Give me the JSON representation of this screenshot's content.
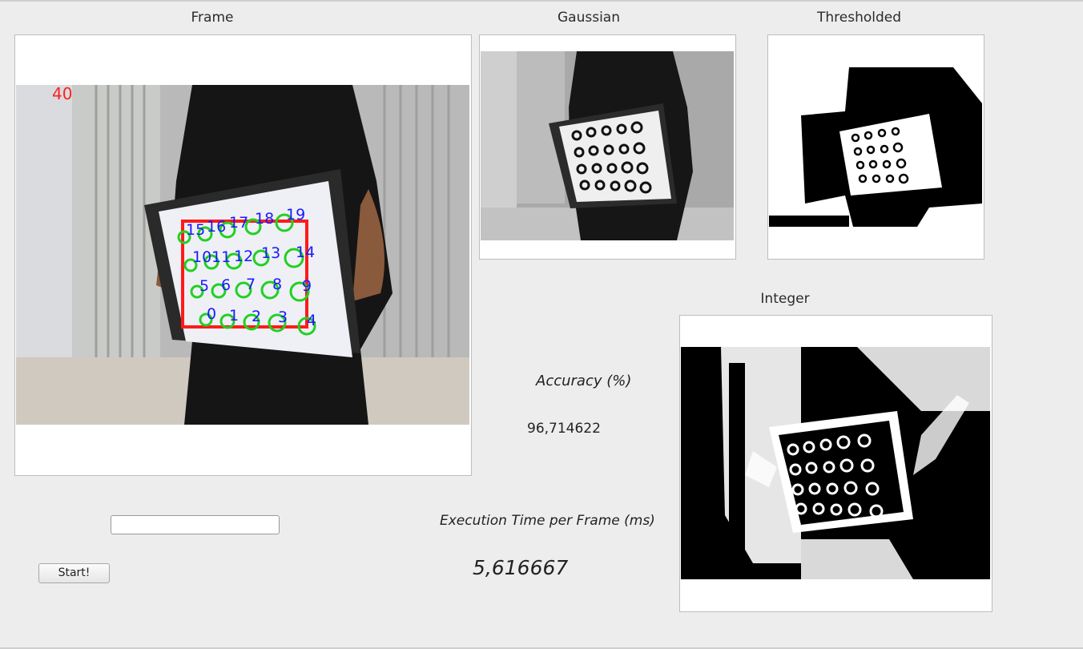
{
  "titles": {
    "frame": "Frame",
    "gaussian": "Gaussian",
    "thresholded": "Thresholded",
    "integer": "Integer"
  },
  "frame_overlay": {
    "frame_counter": "40",
    "point_labels": [
      "0",
      "1",
      "2",
      "3",
      "4",
      "5",
      "6",
      "7",
      "8",
      "9",
      "10",
      "11",
      "12",
      "13",
      "14",
      "15",
      "16",
      "17",
      "18",
      "19"
    ]
  },
  "metrics": {
    "accuracy_label": "Accuracy (%)",
    "accuracy_value": "96,714622",
    "exec_label": "Execution Time per Frame (ms)",
    "exec_value": "5,616667"
  },
  "controls": {
    "input_value": "",
    "start_label": "Start!"
  }
}
